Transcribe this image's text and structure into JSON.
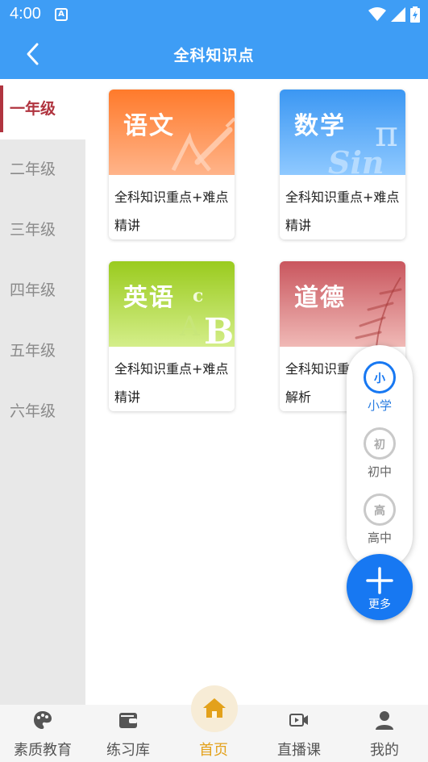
{
  "status_bar": {
    "time": "4:00",
    "notification_letter": "A"
  },
  "header": {
    "title": "全科知识点"
  },
  "sidebar": {
    "items": [
      {
        "label": "一年级",
        "active": true
      },
      {
        "label": "二年级",
        "active": false
      },
      {
        "label": "三年级",
        "active": false
      },
      {
        "label": "四年级",
        "active": false
      },
      {
        "label": "五年级",
        "active": false
      },
      {
        "label": "六年级",
        "active": false
      }
    ]
  },
  "cards": [
    {
      "subject": "语文",
      "description": "全科知识重点+难点精讲",
      "colors": [
        "#ff7a2b",
        "#ffb48a"
      ]
    },
    {
      "subject": "数学",
      "description": "全科知识重点+难点精讲",
      "colors": [
        "#3b97f3",
        "#8fc9ff"
      ]
    },
    {
      "subject": "英语",
      "description": "全科知识重点+难点精讲",
      "colors": [
        "#9acb1e",
        "#d4ee8a"
      ]
    },
    {
      "subject": "道德",
      "description": "全科知识重点+难点解析",
      "colors": [
        "#c9565e",
        "#f0b9b6"
      ]
    }
  ],
  "level_switcher": {
    "options": [
      {
        "label": "小学",
        "icon": "primary-school-icon",
        "active": true
      },
      {
        "label": "初中",
        "icon": "junior-high-icon",
        "active": false
      },
      {
        "label": "高中",
        "icon": "senior-high-icon",
        "active": false
      }
    ],
    "more_label": "更多"
  },
  "bottom_nav": {
    "items": [
      {
        "label": "素质教育",
        "icon": "palette-icon",
        "active": false
      },
      {
        "label": "练习库",
        "icon": "wallet-icon",
        "active": false
      },
      {
        "label": "首页",
        "icon": "home-icon",
        "active": true
      },
      {
        "label": "直播课",
        "icon": "video-icon",
        "active": false
      },
      {
        "label": "我的",
        "icon": "person-icon",
        "active": false
      }
    ]
  },
  "colors": {
    "primary": "#3e9df5",
    "accent_red": "#b0343f",
    "home_active": "#e3a11b",
    "fab": "#1778f2"
  }
}
